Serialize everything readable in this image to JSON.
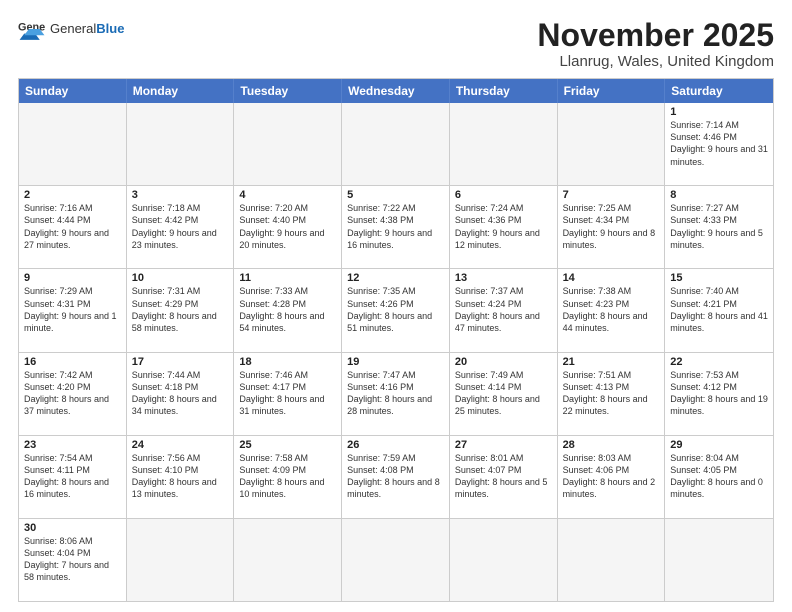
{
  "header": {
    "logo_general": "General",
    "logo_blue": "Blue",
    "month_title": "November 2025",
    "location": "Llanrug, Wales, United Kingdom"
  },
  "days_of_week": [
    "Sunday",
    "Monday",
    "Tuesday",
    "Wednesday",
    "Thursday",
    "Friday",
    "Saturday"
  ],
  "weeks": [
    [
      {
        "day": "",
        "info": "",
        "empty": true
      },
      {
        "day": "",
        "info": "",
        "empty": true
      },
      {
        "day": "",
        "info": "",
        "empty": true
      },
      {
        "day": "",
        "info": "",
        "empty": true
      },
      {
        "day": "",
        "info": "",
        "empty": true
      },
      {
        "day": "",
        "info": "",
        "empty": true
      },
      {
        "day": "1",
        "info": "Sunrise: 7:14 AM\nSunset: 4:46 PM\nDaylight: 9 hours and 31 minutes."
      }
    ],
    [
      {
        "day": "2",
        "info": "Sunrise: 7:16 AM\nSunset: 4:44 PM\nDaylight: 9 hours and 27 minutes."
      },
      {
        "day": "3",
        "info": "Sunrise: 7:18 AM\nSunset: 4:42 PM\nDaylight: 9 hours and 23 minutes."
      },
      {
        "day": "4",
        "info": "Sunrise: 7:20 AM\nSunset: 4:40 PM\nDaylight: 9 hours and 20 minutes."
      },
      {
        "day": "5",
        "info": "Sunrise: 7:22 AM\nSunset: 4:38 PM\nDaylight: 9 hours and 16 minutes."
      },
      {
        "day": "6",
        "info": "Sunrise: 7:24 AM\nSunset: 4:36 PM\nDaylight: 9 hours and 12 minutes."
      },
      {
        "day": "7",
        "info": "Sunrise: 7:25 AM\nSunset: 4:34 PM\nDaylight: 9 hours and 8 minutes."
      },
      {
        "day": "8",
        "info": "Sunrise: 7:27 AM\nSunset: 4:33 PM\nDaylight: 9 hours and 5 minutes."
      }
    ],
    [
      {
        "day": "9",
        "info": "Sunrise: 7:29 AM\nSunset: 4:31 PM\nDaylight: 9 hours and 1 minute."
      },
      {
        "day": "10",
        "info": "Sunrise: 7:31 AM\nSunset: 4:29 PM\nDaylight: 8 hours and 58 minutes."
      },
      {
        "day": "11",
        "info": "Sunrise: 7:33 AM\nSunset: 4:28 PM\nDaylight: 8 hours and 54 minutes."
      },
      {
        "day": "12",
        "info": "Sunrise: 7:35 AM\nSunset: 4:26 PM\nDaylight: 8 hours and 51 minutes."
      },
      {
        "day": "13",
        "info": "Sunrise: 7:37 AM\nSunset: 4:24 PM\nDaylight: 8 hours and 47 minutes."
      },
      {
        "day": "14",
        "info": "Sunrise: 7:38 AM\nSunset: 4:23 PM\nDaylight: 8 hours and 44 minutes."
      },
      {
        "day": "15",
        "info": "Sunrise: 7:40 AM\nSunset: 4:21 PM\nDaylight: 8 hours and 41 minutes."
      }
    ],
    [
      {
        "day": "16",
        "info": "Sunrise: 7:42 AM\nSunset: 4:20 PM\nDaylight: 8 hours and 37 minutes."
      },
      {
        "day": "17",
        "info": "Sunrise: 7:44 AM\nSunset: 4:18 PM\nDaylight: 8 hours and 34 minutes."
      },
      {
        "day": "18",
        "info": "Sunrise: 7:46 AM\nSunset: 4:17 PM\nDaylight: 8 hours and 31 minutes."
      },
      {
        "day": "19",
        "info": "Sunrise: 7:47 AM\nSunset: 4:16 PM\nDaylight: 8 hours and 28 minutes."
      },
      {
        "day": "20",
        "info": "Sunrise: 7:49 AM\nSunset: 4:14 PM\nDaylight: 8 hours and 25 minutes."
      },
      {
        "day": "21",
        "info": "Sunrise: 7:51 AM\nSunset: 4:13 PM\nDaylight: 8 hours and 22 minutes."
      },
      {
        "day": "22",
        "info": "Sunrise: 7:53 AM\nSunset: 4:12 PM\nDaylight: 8 hours and 19 minutes."
      }
    ],
    [
      {
        "day": "23",
        "info": "Sunrise: 7:54 AM\nSunset: 4:11 PM\nDaylight: 8 hours and 16 minutes."
      },
      {
        "day": "24",
        "info": "Sunrise: 7:56 AM\nSunset: 4:10 PM\nDaylight: 8 hours and 13 minutes."
      },
      {
        "day": "25",
        "info": "Sunrise: 7:58 AM\nSunset: 4:09 PM\nDaylight: 8 hours and 10 minutes."
      },
      {
        "day": "26",
        "info": "Sunrise: 7:59 AM\nSunset: 4:08 PM\nDaylight: 8 hours and 8 minutes."
      },
      {
        "day": "27",
        "info": "Sunrise: 8:01 AM\nSunset: 4:07 PM\nDaylight: 8 hours and 5 minutes."
      },
      {
        "day": "28",
        "info": "Sunrise: 8:03 AM\nSunset: 4:06 PM\nDaylight: 8 hours and 2 minutes."
      },
      {
        "day": "29",
        "info": "Sunrise: 8:04 AM\nSunset: 4:05 PM\nDaylight: 8 hours and 0 minutes."
      }
    ],
    [
      {
        "day": "30",
        "info": "Sunrise: 8:06 AM\nSunset: 4:04 PM\nDaylight: 7 hours and 58 minutes."
      },
      {
        "day": "",
        "info": "",
        "empty": true
      },
      {
        "day": "",
        "info": "",
        "empty": true
      },
      {
        "day": "",
        "info": "",
        "empty": true
      },
      {
        "day": "",
        "info": "",
        "empty": true
      },
      {
        "day": "",
        "info": "",
        "empty": true
      },
      {
        "day": "",
        "info": "",
        "empty": true
      }
    ]
  ]
}
